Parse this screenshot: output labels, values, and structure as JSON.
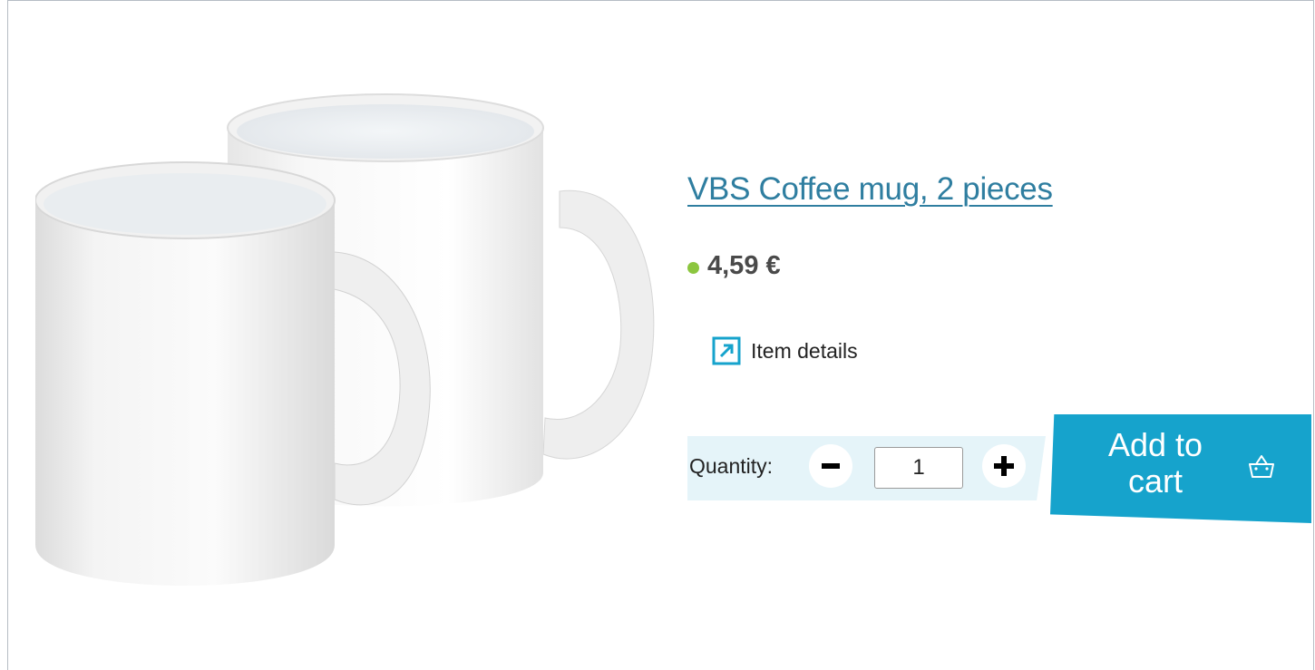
{
  "product": {
    "title": "VBS Coffee mug, 2 pieces",
    "price": "4,59 €",
    "availability_color": "#8cc63f",
    "image_icon": "white-coffee-mugs-image"
  },
  "details": {
    "label": "Item details",
    "icon": "external-link-arrow-icon"
  },
  "quantity": {
    "label": "Quantity:",
    "value": "1",
    "decrement_icon": "minus-icon",
    "increment_icon": "plus-icon"
  },
  "cart": {
    "label_line1": "Add to",
    "label_line2": "cart",
    "icon": "shopping-basket-icon"
  },
  "colors": {
    "accent": "#16a3cc",
    "link": "#2f7ea0",
    "quantity_band": "#e5f4f9",
    "border": "#b6bdc4"
  }
}
